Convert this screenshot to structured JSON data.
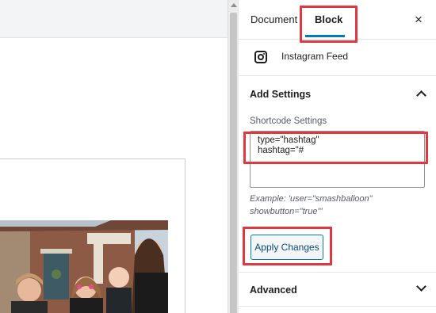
{
  "sidebar": {
    "tabs": [
      {
        "label": "Document"
      },
      {
        "label": "Block"
      }
    ],
    "close_label": "×",
    "block_card": {
      "title": "Instagram Feed",
      "icon": "instagram-icon"
    },
    "add_settings": {
      "title": "Add Settings",
      "field_label": "Shortcode Settings",
      "field_value": "type=\"hashtag\"\nhashtag=\"#",
      "example_text": "Example: 'user=\"smashballoon\" showbutton=\"true\"'",
      "apply_label": "Apply Changes"
    },
    "advanced": {
      "title": "Advanced"
    }
  },
  "colors": {
    "accent": "#007cba",
    "highlight": "#e0383e"
  }
}
